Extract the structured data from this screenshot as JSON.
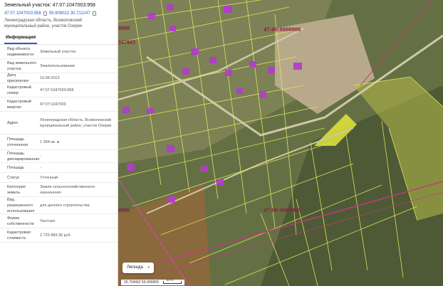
{
  "header": {
    "title": "Земельный участок: 47:07:1047003:958",
    "cadastral_short": "47:07:1047003:958",
    "coords": "59.908022 30.711247",
    "address": "Ленинградская область, Всеволожский муниципальный район, участок Озерки"
  },
  "tabs": [
    {
      "label": "Информация"
    }
  ],
  "rows": [
    {
      "key": "Вид объекта недвижимости",
      "value": "Земельный участок"
    },
    {
      "key": "Вид земельного участка",
      "value": "Землепользования"
    },
    {
      "key": "Дата присвоения",
      "value": "13.08.2013"
    },
    {
      "key": "Кадастровый номер",
      "value": "47:07:1047003:958"
    },
    {
      "key": "Кадастровый квартал",
      "value": "47:07:1047003"
    },
    {
      "key": "Адрес",
      "value": "Ленинградская область, Всеволожский муниципальный район, участок Озерки"
    },
    {
      "key": "Площадь уточненная",
      "value": "1 394 кв. м"
    },
    {
      "key": "Площадь декларированная",
      "value": "-"
    },
    {
      "key": "Площадь",
      "value": "-"
    },
    {
      "key": "Статус",
      "value": "Учтенный"
    },
    {
      "key": "Категория земель",
      "value": "Земли сельскохозяйственного назначения"
    },
    {
      "key": "Вид разрешенного использования",
      "value": "для дачного строительства"
    },
    {
      "key": "Форма собственности",
      "value": "Частная"
    },
    {
      "key": "Кадастровая стоимость",
      "value": "2 725 883.36 руб."
    }
  ],
  "map": {
    "labels": {
      "quarter_top": "47:00:0000000",
      "quarter_mid": "47:00:0000000",
      "left_top": "0000",
      "left_mid": "0000",
      "left_code": "047003"
    },
    "legend_button": "Легенда",
    "footer_coords": "30.704952  59.906809",
    "scale": "50 m",
    "colors": {
      "parcel_outline": "#e6e85a",
      "selected_fill": "#e2e63a",
      "building": "#b33bd1",
      "boundary_line": "#c33a7c",
      "label_text": "#8b1e3f"
    }
  }
}
